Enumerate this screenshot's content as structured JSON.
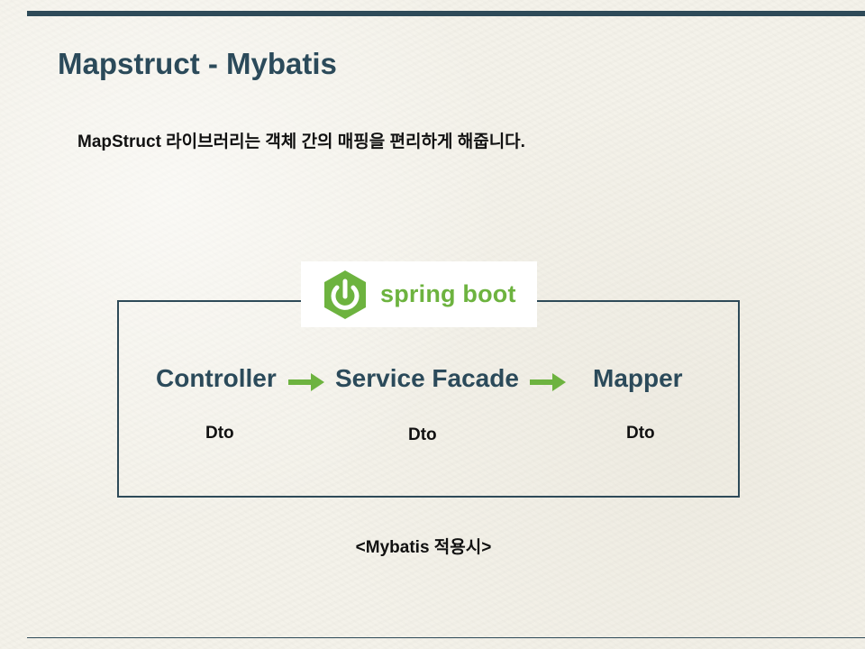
{
  "slide": {
    "title": "Mapstruct - Mybatis",
    "subtitle": "MapStruct 라이브러리는 객체 간의 매핑을 편리하게 해줍니다.",
    "caption": "<Mybatis 적용시>"
  },
  "logo": {
    "text": "spring boot",
    "icon": "power-icon",
    "color": "#6db33f"
  },
  "flow": {
    "nodes": [
      {
        "label": "Controller",
        "sub": "Dto"
      },
      {
        "label": "Service Facade",
        "sub": "Dto"
      },
      {
        "label": "Mapper",
        "sub": "Dto"
      }
    ],
    "arrow_color": "#6db33f"
  },
  "colors": {
    "heading": "#2b4a5a",
    "rule": "#2e4a58",
    "text": "#111111"
  }
}
